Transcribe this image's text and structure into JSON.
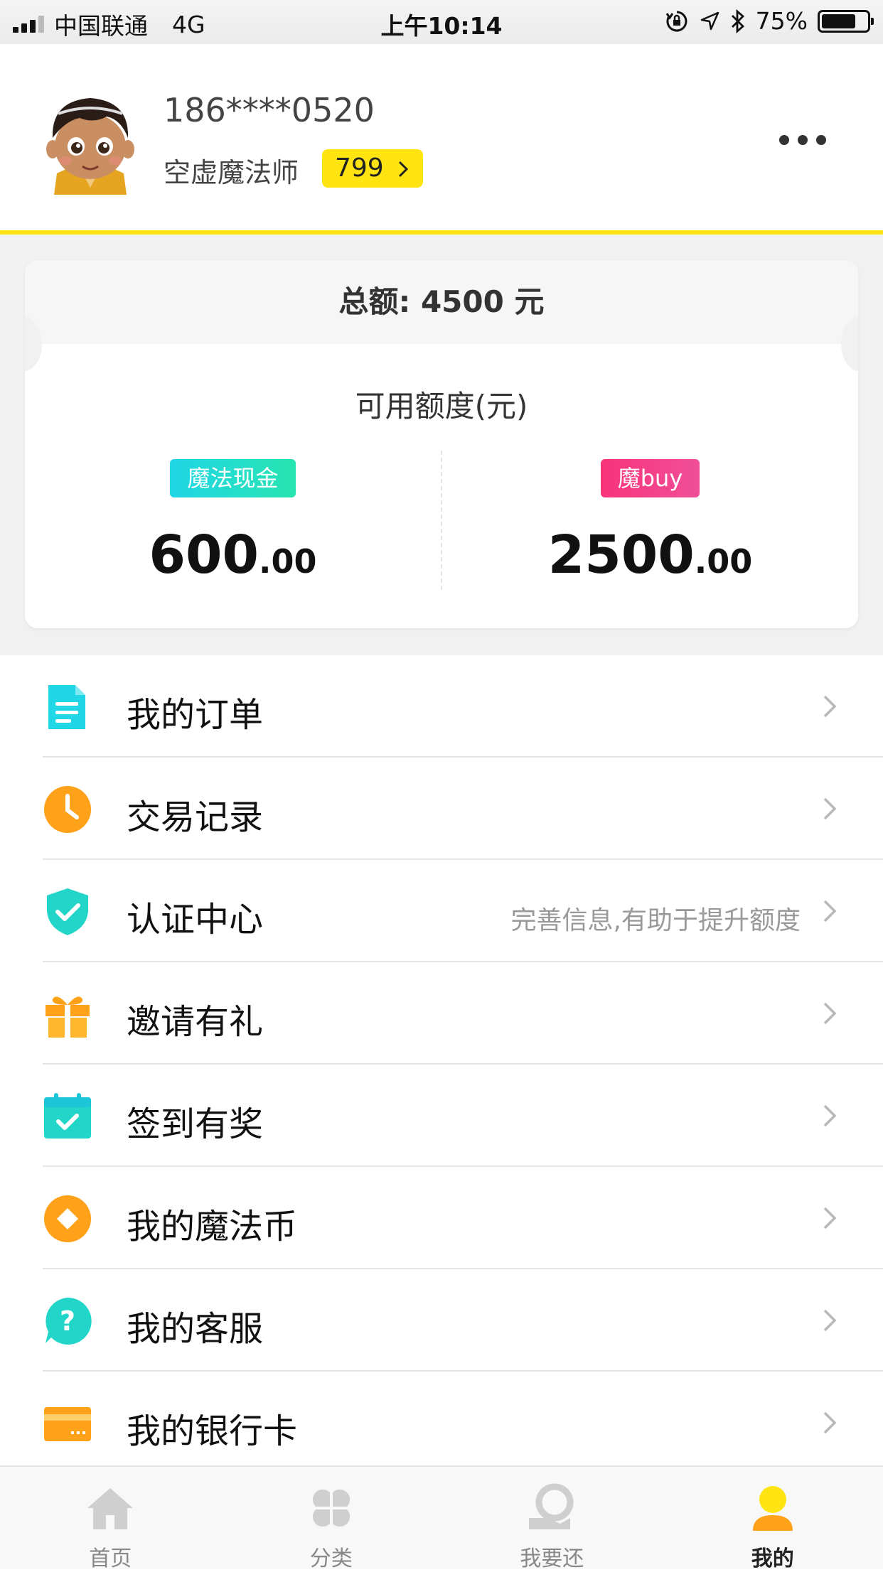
{
  "status_bar": {
    "carrier": "中国联通",
    "network": "4G",
    "time": "上午10:14",
    "battery": "75%",
    "battery_level": 0.75
  },
  "profile": {
    "phone": "186****0520",
    "nickname": "空虚魔法师",
    "level": "799"
  },
  "credit_card": {
    "total": "总额: 4500 元",
    "available_label": "可用额度(元)",
    "cash": {
      "tag": "魔法现金",
      "integer": "600",
      "decimal": ".00"
    },
    "buy": {
      "tag": "魔buy",
      "integer": "2500",
      "decimal": ".00"
    }
  },
  "menu": [
    {
      "label": "我的订单",
      "icon": "order-icon",
      "hint": ""
    },
    {
      "label": "交易记录",
      "icon": "clock-icon",
      "hint": ""
    },
    {
      "label": "认证中心",
      "icon": "shield-check-icon",
      "hint": "完善信息,有助于提升额度"
    },
    {
      "label": "邀请有礼",
      "icon": "gift-icon",
      "hint": ""
    },
    {
      "label": "签到有奖",
      "icon": "calendar-check-icon",
      "hint": ""
    },
    {
      "label": "我的魔法币",
      "icon": "coin-icon",
      "hint": ""
    },
    {
      "label": "我的客服",
      "icon": "help-icon",
      "hint": ""
    },
    {
      "label": "我的银行卡",
      "icon": "bank-card-icon",
      "hint": ""
    }
  ],
  "tabbar": [
    {
      "label": "首页",
      "icon": "home-icon"
    },
    {
      "label": "分类",
      "icon": "category-icon"
    },
    {
      "label": "我要还",
      "icon": "repay-icon"
    },
    {
      "label": "我的",
      "icon": "user-icon",
      "active": true
    }
  ],
  "colors": {
    "accent_yellow": "#ffe411",
    "cyan": "#21d6e6",
    "orange": "#ff9f0a",
    "pink": "#f8337a"
  }
}
